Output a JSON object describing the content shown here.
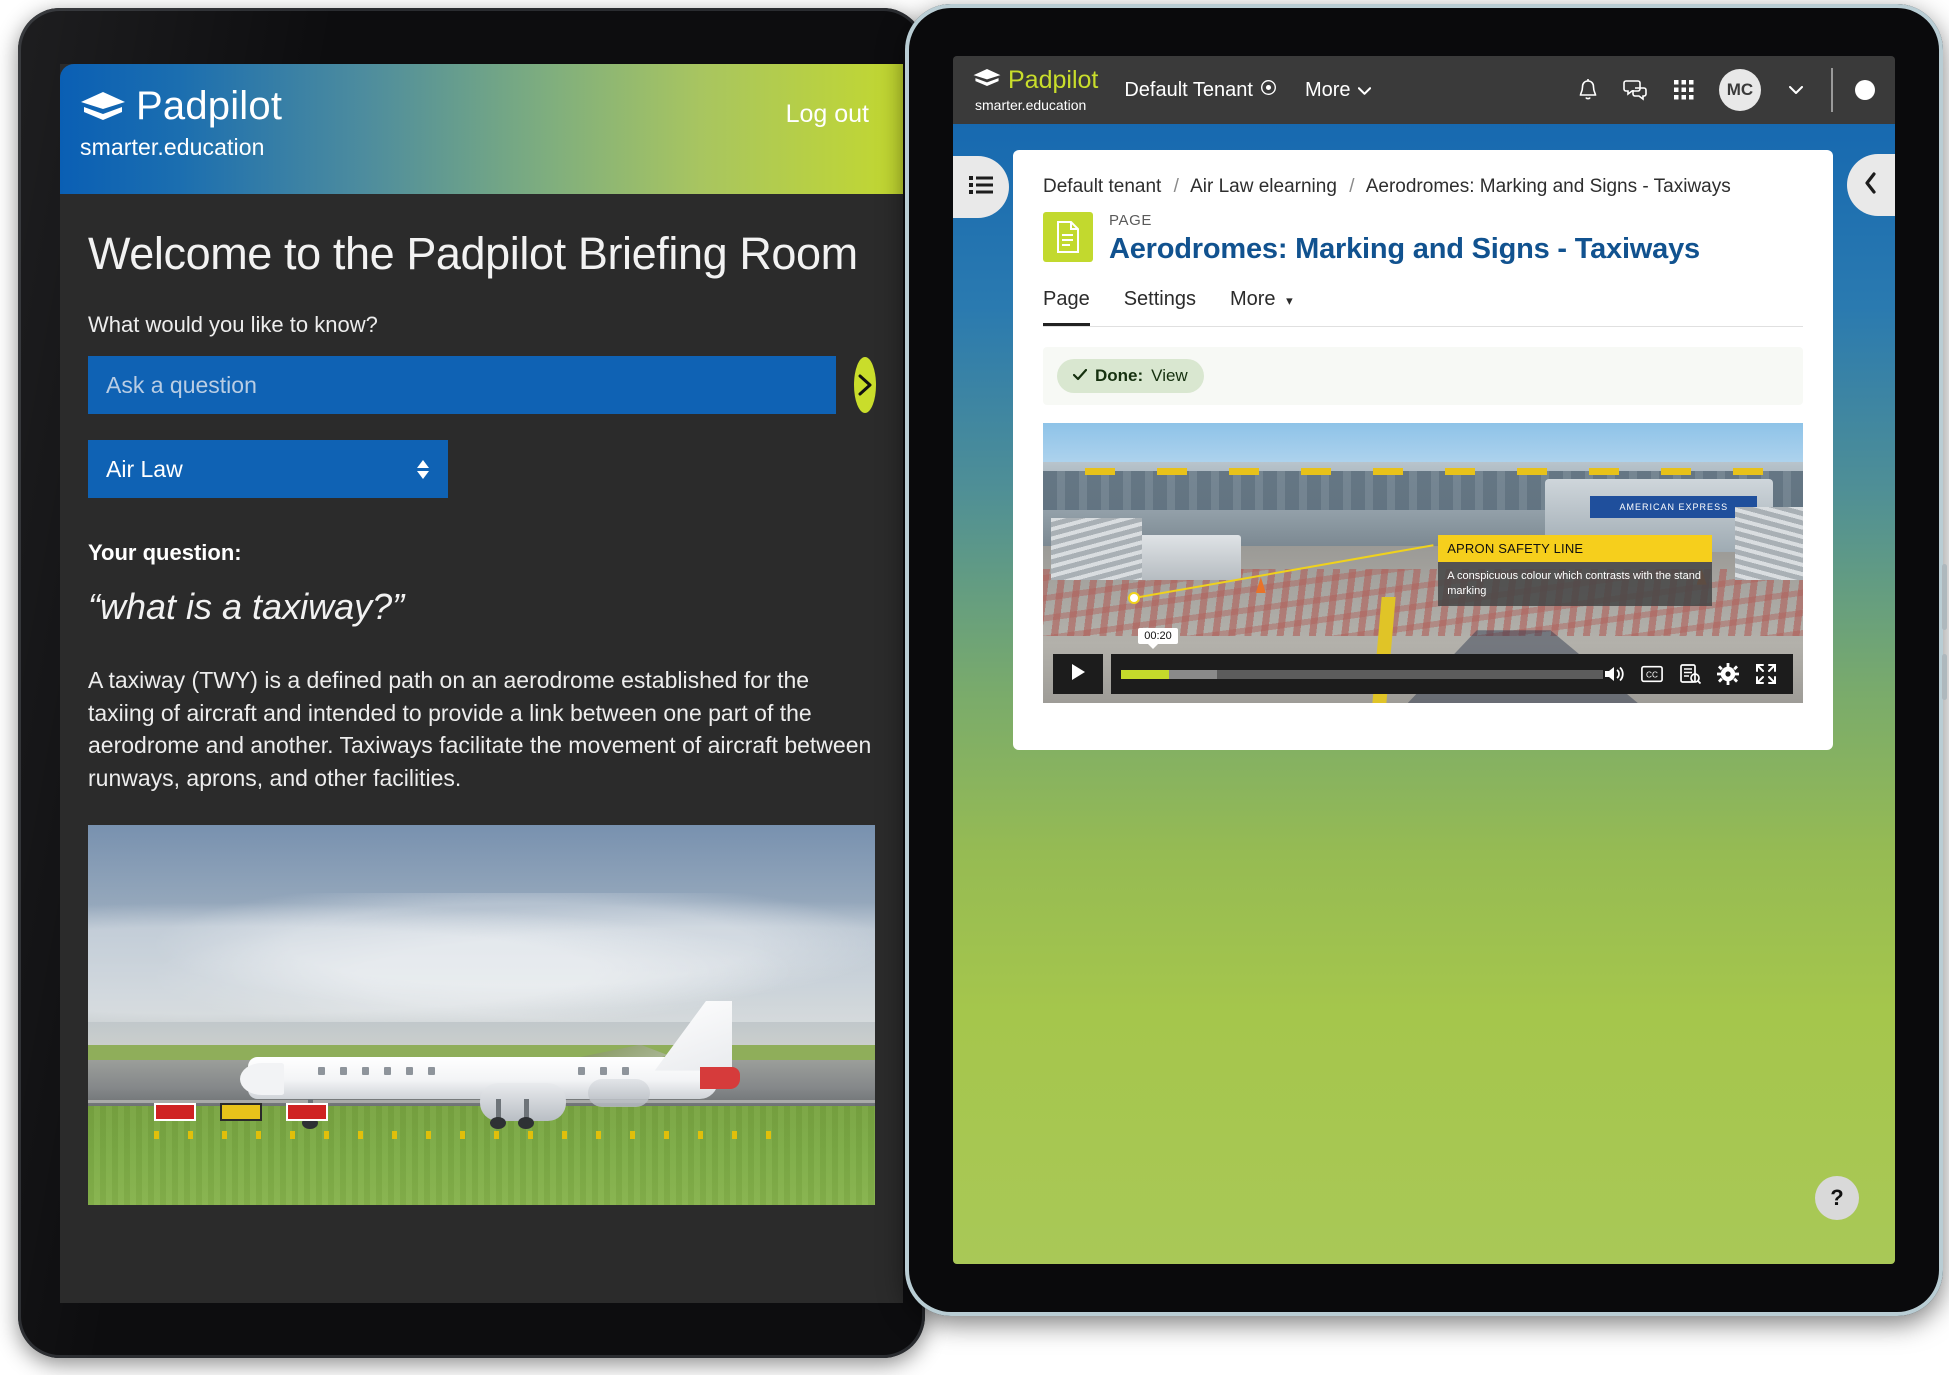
{
  "left_device": {
    "header": {
      "brand_name": "Padpilot",
      "brand_tagline": "smarter.education",
      "logout_label": "Log out",
      "gradient_from": "#0a5fb4",
      "gradient_to": "#c3d82f"
    },
    "welcome_title": "Welcome to the Padpilot Briefing Room",
    "ask_label": "What would you like to know?",
    "ask_placeholder": "Ask a question",
    "ask_value": "",
    "send_icon": "chevron-right-icon",
    "subject_selected": "Air Law",
    "your_question_label": "Your question:",
    "your_question": "“what is a taxiway?”",
    "answer": "A taxiway (TWY) is a defined path on an aerodrome established for the taxiing of aircraft and intended to provide a link between one part of the aerodrome and another. Taxiways facilitate the movement of aircraft between runways, aprons, and other facilities.",
    "scene_alt": "Airliner taxiing on a grass-lined runway in mist"
  },
  "right_device": {
    "topbar": {
      "brand_name": "Padpilot",
      "brand_tagline": "smarter.education",
      "brand_color": "#c9dd2b",
      "tenant_label": "Default Tenant",
      "tenant_icon": "target-icon",
      "more_label": "More",
      "more_icon": "chevron-down-icon",
      "icons": [
        "bell-icon",
        "chat-icon",
        "apps-grid-icon"
      ],
      "avatar_initials": "MC",
      "avatar_chevron": "chevron-down-icon",
      "status_dot": "white-dot-icon",
      "background": "#3a3a3a"
    },
    "sidebar_toggle_icon": "list-menu-icon",
    "collapse_icon": "chevron-left-icon",
    "breadcrumb": [
      "Default tenant",
      "Air Law elearning",
      "Aerodromes: Marking and Signs - Taxiways"
    ],
    "breadcrumb_separator": "/",
    "page_kicker": "PAGE",
    "page_title": "Aerodromes: Marking and Signs - Taxiways",
    "page_icon": "document-icon",
    "page_icon_color": "#c2d92e",
    "title_color": "#11528f",
    "tabs": [
      {
        "label": "Page",
        "active": true
      },
      {
        "label": "Settings",
        "active": false
      },
      {
        "label": "More",
        "active": false,
        "icon": "chevron-down-icon"
      }
    ],
    "completion": {
      "check_icon": "check-icon",
      "status": "Done:",
      "action": "View",
      "pill_bg": "#d9e7d0"
    },
    "video": {
      "callout_title": "APRON SAFETY LINE",
      "callout_body": "A conspicuous colour which contrasts with the stand marking",
      "callout_title_bg": "#f6cf1c",
      "signage_label": "AMERICAN EXPRESS",
      "play_icon": "play-icon",
      "current_time": "00:20",
      "progress_percent": 10,
      "buffered_percent": 20,
      "progress_color": "#c4da2b",
      "controls": [
        "volume-icon",
        "captions-cc-icon",
        "transcript-icon",
        "settings-gear-icon",
        "fullscreen-icon"
      ]
    },
    "help_label": "?",
    "background_gradient_from": "#1769b0",
    "background_gradient_to": "#a9c857"
  }
}
